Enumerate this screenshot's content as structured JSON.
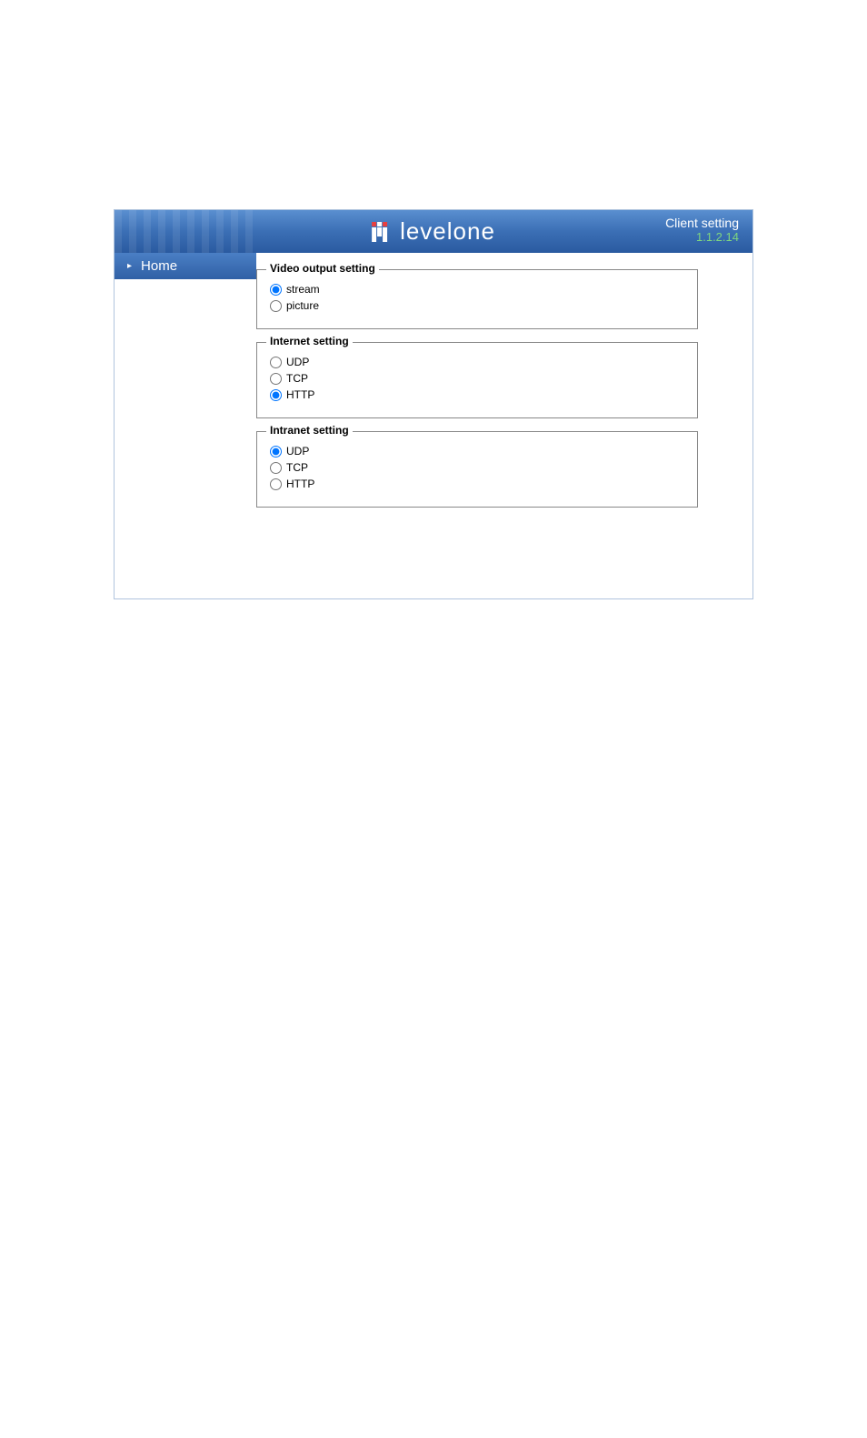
{
  "header": {
    "logo_text": "levelone",
    "client_setting": "Client setting",
    "version": "1.1.2.14"
  },
  "sidebar": {
    "items": [
      {
        "label": "Home"
      }
    ]
  },
  "fieldsets": {
    "video_output": {
      "legend": "Video output setting",
      "options": [
        {
          "label": "stream",
          "checked": true
        },
        {
          "label": "picture",
          "checked": false
        }
      ]
    },
    "internet": {
      "legend": "Internet setting",
      "options": [
        {
          "label": "UDP",
          "checked": false
        },
        {
          "label": "TCP",
          "checked": false
        },
        {
          "label": "HTTP",
          "checked": true
        }
      ]
    },
    "intranet": {
      "legend": "Intranet setting",
      "options": [
        {
          "label": "UDP",
          "checked": true
        },
        {
          "label": "TCP",
          "checked": false
        },
        {
          "label": "HTTP",
          "checked": false
        }
      ]
    }
  }
}
